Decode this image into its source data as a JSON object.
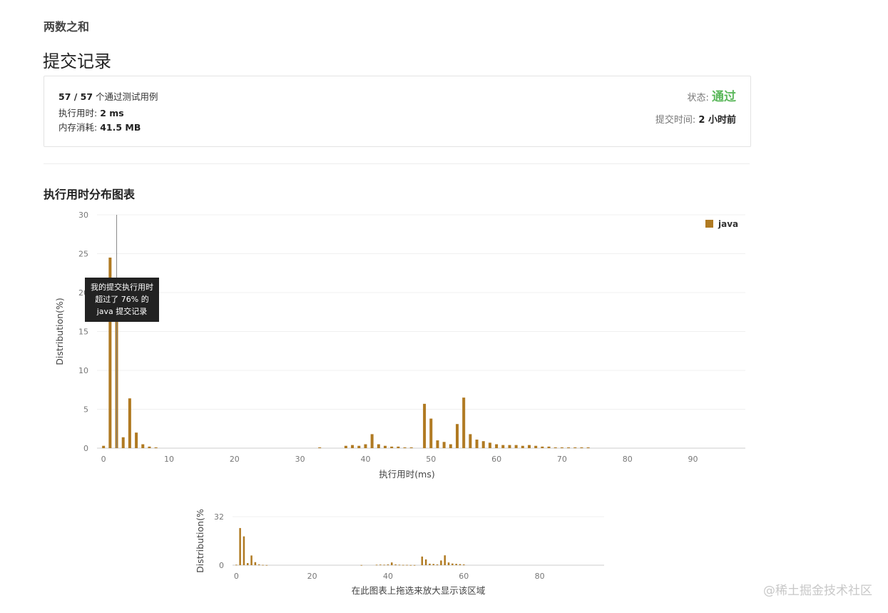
{
  "problem": {
    "title": "两数之和"
  },
  "page": {
    "title": "提交记录"
  },
  "submission": {
    "cases_passed": "57 / 57",
    "cases_text": " 个通过测试用例",
    "runtime_label": "执行用时: ",
    "runtime_value": "2 ms",
    "memory_label": "内存消耗: ",
    "memory_value": "41.5 MB",
    "status_label": "状态:",
    "status_value": "通过",
    "submitted_label": "提交时间:",
    "submitted_value": "2 小时前"
  },
  "colors": {
    "bar": "#b07a22",
    "accepted": "#5cb85c"
  },
  "chart_section": {
    "title": "执行用时分布图表"
  },
  "chart_data": [
    {
      "type": "bar",
      "title": "",
      "xlabel": "执行用时(ms)",
      "ylabel": "Distribution(%)",
      "ylim": [
        0,
        30
      ],
      "xlim": [
        -1,
        98
      ],
      "xticks": [
        0,
        10,
        20,
        30,
        40,
        50,
        60,
        70,
        80,
        90
      ],
      "yticks": [
        0,
        5,
        10,
        15,
        20,
        25,
        30
      ],
      "grid": true,
      "legend": "top-right",
      "series": [
        {
          "name": "java",
          "x": [
            0,
            1,
            2,
            3,
            4,
            5,
            6,
            7,
            8,
            33,
            37,
            38,
            39,
            40,
            41,
            42,
            43,
            44,
            45,
            46,
            47,
            49,
            50,
            51,
            52,
            53,
            54,
            55,
            56,
            57,
            58,
            59,
            60,
            61,
            62,
            63,
            64,
            65,
            66,
            67,
            68,
            69,
            70,
            71,
            72,
            73,
            74
          ],
          "values": [
            0.3,
            24.5,
            17.5,
            1.4,
            6.4,
            2.0,
            0.5,
            0.2,
            0.1,
            0.1,
            0.3,
            0.4,
            0.3,
            0.5,
            1.8,
            0.5,
            0.3,
            0.2,
            0.2,
            0.1,
            0.1,
            5.7,
            3.8,
            1.0,
            0.8,
            0.5,
            3.1,
            6.5,
            1.8,
            1.1,
            0.9,
            0.7,
            0.5,
            0.4,
            0.4,
            0.4,
            0.3,
            0.4,
            0.3,
            0.2,
            0.2,
            0.1,
            0.1,
            0.1,
            0.1,
            0.1,
            0.1
          ]
        }
      ],
      "marker": {
        "x": 2,
        "tooltip": [
          "我的提交执行用时",
          "超过了 76% 的",
          "java 提交记录"
        ]
      }
    },
    {
      "type": "bar",
      "title": "",
      "xlabel": "在此图表上拖选来放大显示该区域",
      "ylabel": "Distribution(%",
      "ylim": [
        0,
        32
      ],
      "xlim": [
        -1,
        97
      ],
      "xticks": [
        0,
        20,
        40,
        60,
        80
      ],
      "yticks": [
        0,
        32
      ],
      "grid": true,
      "series": [
        {
          "name": "java",
          "x": [
            0,
            1,
            2,
            3,
            4,
            5,
            6,
            7,
            8,
            33,
            37,
            38,
            39,
            40,
            41,
            42,
            43,
            44,
            45,
            46,
            47,
            49,
            50,
            51,
            52,
            53,
            54,
            55,
            56,
            57,
            58,
            59,
            60
          ],
          "values": [
            0.3,
            24.5,
            19.0,
            1.4,
            6.4,
            2.0,
            0.5,
            0.2,
            0.1,
            0.1,
            0.3,
            0.4,
            0.3,
            0.5,
            1.8,
            0.5,
            0.3,
            0.2,
            0.2,
            0.1,
            0.1,
            5.7,
            3.8,
            1.0,
            0.8,
            0.5,
            3.1,
            6.5,
            1.8,
            1.1,
            0.9,
            0.7,
            0.5
          ]
        }
      ]
    }
  ],
  "watermark": "@稀土掘金技术社区"
}
